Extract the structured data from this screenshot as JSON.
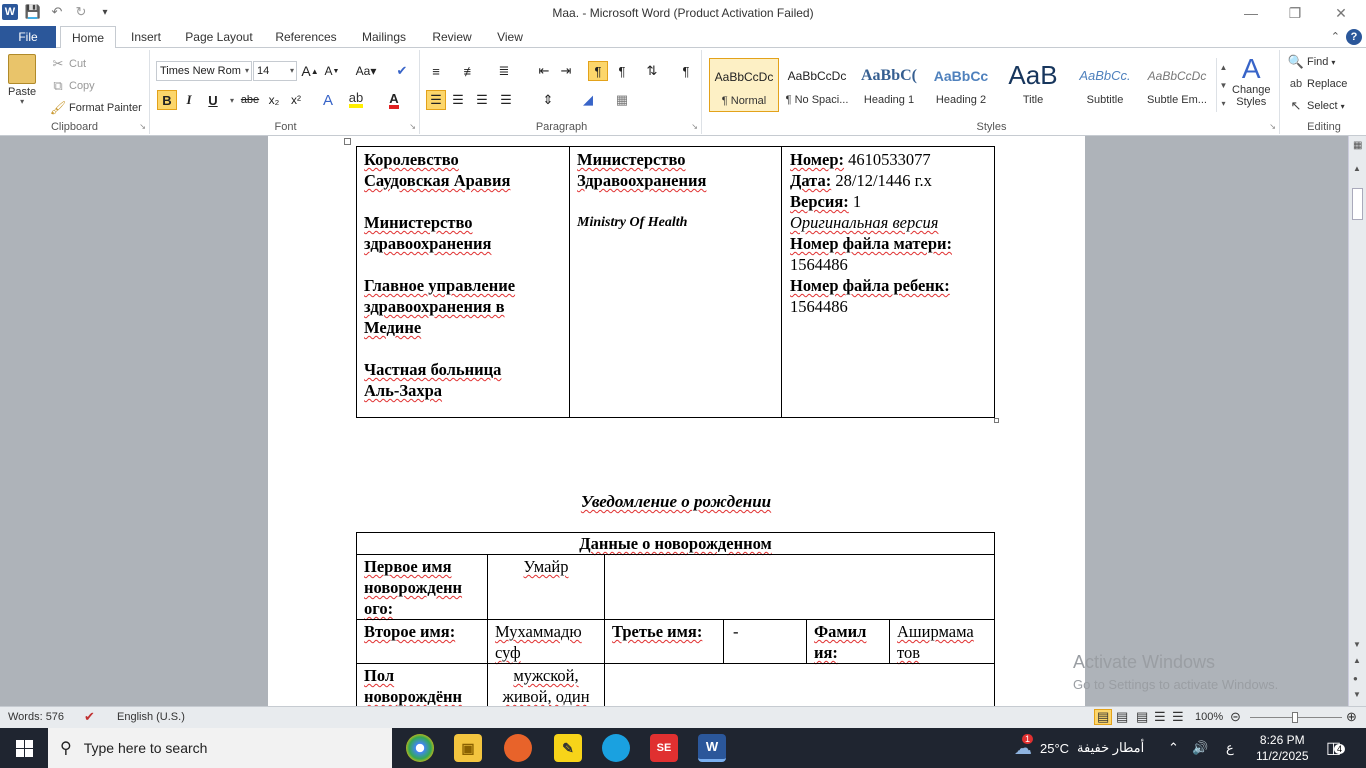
{
  "window": {
    "title": "Maa.  -  Microsoft Word (Product Activation Failed)",
    "app_icon": "W"
  },
  "tabs": [
    "File",
    "Home",
    "Insert",
    "Page Layout",
    "References",
    "Mailings",
    "Review",
    "View"
  ],
  "ribbon": {
    "clipboard": {
      "paste": "Paste",
      "cut": "Cut",
      "copy": "Copy",
      "format_painter": "Format Painter",
      "label": "Clipboard"
    },
    "font": {
      "name": "Times New Rom",
      "size": "14",
      "label": "Font",
      "bold": "B",
      "italic": "I",
      "underline": "U",
      "strike": "abe",
      "sub": "x₂",
      "sup": "x²"
    },
    "paragraph": {
      "label": "Paragraph"
    },
    "styles": {
      "label": "Styles",
      "items": [
        {
          "preview": "AaBbCcDc",
          "name": "¶ Normal"
        },
        {
          "preview": "AaBbCcDc",
          "name": "¶ No Spaci..."
        },
        {
          "preview": "AaBbC(",
          "name": "Heading 1"
        },
        {
          "preview": "AaBbCc",
          "name": "Heading 2"
        },
        {
          "preview": "AaB",
          "name": "Title"
        },
        {
          "preview": "AaBbCc.",
          "name": "Subtitle"
        },
        {
          "preview": "AaBbCcDc",
          "name": "Subtle Em..."
        }
      ],
      "change_styles_1": "Change",
      "change_styles_2": "Styles"
    },
    "editing": {
      "find": "Find",
      "replace": "Replace",
      "select": "Select",
      "label": "Editing"
    }
  },
  "document": {
    "header": {
      "col1": [
        "Королевство",
        "Саудовская Аравия",
        "",
        "Министерство",
        "здравоохранения",
        "",
        "Главное управление",
        "здравоохранения в",
        "Медине",
        "",
        "Частная больница",
        "Аль-Захра"
      ],
      "col2_bold": [
        "Министерство",
        "Здравоохранения"
      ],
      "col2_italic": "Ministry  Of Health",
      "col3": {
        "number_label": "Номер:",
        "number_value": " 4610533077",
        "date_label": "Дата:",
        "date_value": "  28/12/1446 г.х",
        "version_label": "Версия:",
        "version_value": " 1",
        "version_note": "Оригинальная версия",
        "mother_file_label": "Номер файла матери:",
        "mother_file_value": "1564486",
        "child_file_label": "Номер файла ребенк:",
        "child_file_value": "1564486"
      }
    },
    "heading": "Уведомление о рождении",
    "newborn": {
      "title": "Данные о новорожденном",
      "first_name_label": [
        "Первое имя",
        "новорожденн",
        "ого:"
      ],
      "first_name_value": "Умайр",
      "second_name_label": "Второе имя:",
      "second_name_value": [
        "Мухаммадю",
        "суф"
      ],
      "third_name_label": "Третье имя:",
      "third_name_value": "-",
      "surname_label": [
        "Фамил",
        "ия:"
      ],
      "surname_value": [
        "Аширмама",
        "тов"
      ],
      "sex_label": [
        "Пол",
        "новорождённ"
      ],
      "sex_value": [
        "мужской,",
        "живой, один"
      ]
    }
  },
  "statusbar": {
    "words": "Words: 576",
    "language": "English (U.S.)",
    "zoom": "100%"
  },
  "watermark": {
    "line1": "Activate Windows",
    "line2": "Go to Settings to activate Windows."
  },
  "taskbar": {
    "search_placeholder": "Type here to search",
    "weather_temp": "25°C",
    "weather_text": "أمطار خفيفة",
    "lang": "ع",
    "time": "8:26 PM",
    "date": "11/2/2025",
    "notifications": "4",
    "weather_badge": "1"
  }
}
